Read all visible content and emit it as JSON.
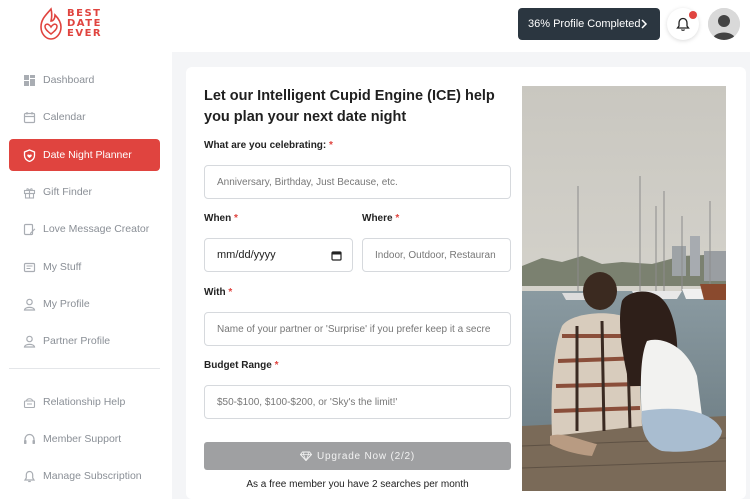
{
  "brand": {
    "line1": "BEST",
    "line2": "DATE",
    "line3": "EVER",
    "color": "#e0443f"
  },
  "header": {
    "progress_label": "36% Profile Completed",
    "notification_dot": true
  },
  "sidebar": {
    "items": [
      {
        "label": "Dashboard",
        "icon": "dashboard-icon",
        "active": false
      },
      {
        "label": "Calendar",
        "icon": "calendar-icon",
        "active": false
      },
      {
        "label": "Date Night Planner",
        "icon": "shield-heart-icon",
        "active": true
      },
      {
        "label": "Gift Finder",
        "icon": "gift-icon",
        "active": false
      },
      {
        "label": "Love Message Creator",
        "icon": "message-edit-icon",
        "active": false
      },
      {
        "label": "My Stuff",
        "icon": "folder-icon",
        "active": false
      },
      {
        "label": "My Profile",
        "icon": "user-icon",
        "active": false
      },
      {
        "label": "Partner Profile",
        "icon": "user-icon",
        "active": false
      }
    ],
    "secondary": [
      {
        "label": "Relationship Help",
        "icon": "help-icon"
      },
      {
        "label": "Member Support",
        "icon": "headset-icon"
      },
      {
        "label": "Manage Subscription",
        "icon": "bell-icon"
      }
    ]
  },
  "planner": {
    "heading": "Let our Intelligent Cupid Engine (ICE) help you plan your next date night",
    "celebrating": {
      "label": "What are you celebrating:",
      "placeholder": "Anniversary, Birthday, Just Because, etc."
    },
    "when": {
      "label": "When",
      "value": "mm/dd/yyyy"
    },
    "where": {
      "label": "Where",
      "placeholder": "Indoor, Outdoor, Restauran"
    },
    "with": {
      "label": "With",
      "placeholder": "Name of your partner or 'Surprise' if you prefer keep it a secre"
    },
    "budget": {
      "label": "Budget Range",
      "placeholder": "$50-$100, $100-$200, or 'Sky's the limit!'"
    },
    "required_mark": "*",
    "upgrade_label": "Upgrade Now (2/2)",
    "free_note": "As a free member you have 2 searches per month"
  },
  "colors": {
    "accent": "#e0443f",
    "dark_button": "#2b3640",
    "disabled_button": "#9fa0a2"
  }
}
